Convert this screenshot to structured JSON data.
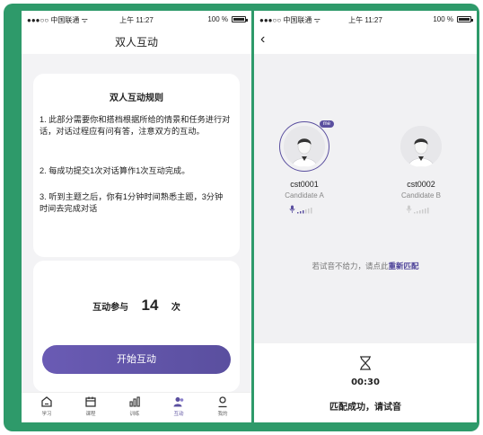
{
  "left_screen": {
    "status_bar": {
      "carrier": "●●●○○ 中国联通 ᯤ",
      "time": "上午 11:27",
      "battery": "100 %"
    },
    "nav_title": "双人互动",
    "rules": {
      "title": "双人互动规则",
      "items": [
        "1. 此部分需要你和搭档根据所给的情景和任务进行对话，对话过程应有问有答，注意双方的互动。",
        "2. 每成功提交1次对话算作1次互动完成。",
        "3. 听到主题之后，你有1分钟时间熟悉主题，3分钟时间去完成对话"
      ]
    },
    "participation": {
      "label": "互动参与",
      "count": "14",
      "unit": "次"
    },
    "start_button": "开始互动",
    "tabs": [
      {
        "label": "学习",
        "icon": "home-icon",
        "active": false
      },
      {
        "label": "课程",
        "icon": "calendar-icon",
        "active": false
      },
      {
        "label": "训练",
        "icon": "bar-chart-icon",
        "active": false
      },
      {
        "label": "互动",
        "icon": "people-icon",
        "active": true
      },
      {
        "label": "我的",
        "icon": "user-icon",
        "active": false
      }
    ]
  },
  "right_screen": {
    "status_bar": {
      "carrier": "●●●○○ 中国联通 ᯤ",
      "time": "上午 11:27",
      "battery": "100 %"
    },
    "candidates": [
      {
        "id": "cst0001",
        "role": "Candidate A",
        "is_me": true,
        "badge": "me"
      },
      {
        "id": "cst0002",
        "role": "Candidate B",
        "is_me": false
      }
    ],
    "hint_text": "若试音不给力，请点此",
    "hint_link": "重新匹配",
    "timer": "00:30",
    "status": "匹配成功，请试音"
  },
  "colors": {
    "frame": "#2e9a6a",
    "accent": "#5a4f9f"
  }
}
